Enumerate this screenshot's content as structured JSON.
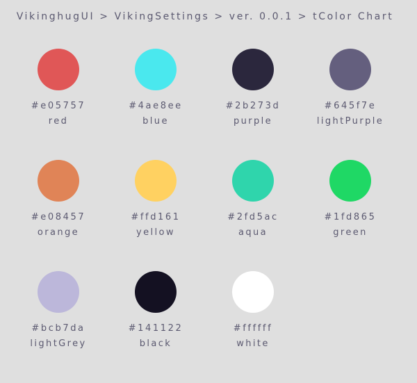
{
  "breadcrumb": {
    "text": "VikinghugUI > VikingSettings > ver. 0.0.1 > tColor Chart"
  },
  "swatches": [
    {
      "hex": "#e05757",
      "name": "red",
      "color": "#e05757"
    },
    {
      "hex": "#4ae8ee",
      "name": "blue",
      "color": "#4ae8ee"
    },
    {
      "hex": "#2b273d",
      "name": "purple",
      "color": "#2b273d"
    },
    {
      "hex": "#645f7e",
      "name": "lightPurple",
      "color": "#645f7e"
    },
    {
      "hex": "#e08457",
      "name": "orange",
      "color": "#e08457"
    },
    {
      "hex": "#ffd161",
      "name": "yellow",
      "color": "#ffd161"
    },
    {
      "hex": "#2fd5ac",
      "name": "aqua",
      "color": "#2fd5ac"
    },
    {
      "hex": "#1fd865",
      "name": "green",
      "color": "#1fd865"
    },
    {
      "hex": "#bcb7da",
      "name": "lightGrey",
      "color": "#bcb7da"
    },
    {
      "hex": "#141122",
      "name": "black",
      "color": "#141122"
    },
    {
      "hex": "#ffffff",
      "name": "white",
      "color": "#ffffff"
    }
  ]
}
